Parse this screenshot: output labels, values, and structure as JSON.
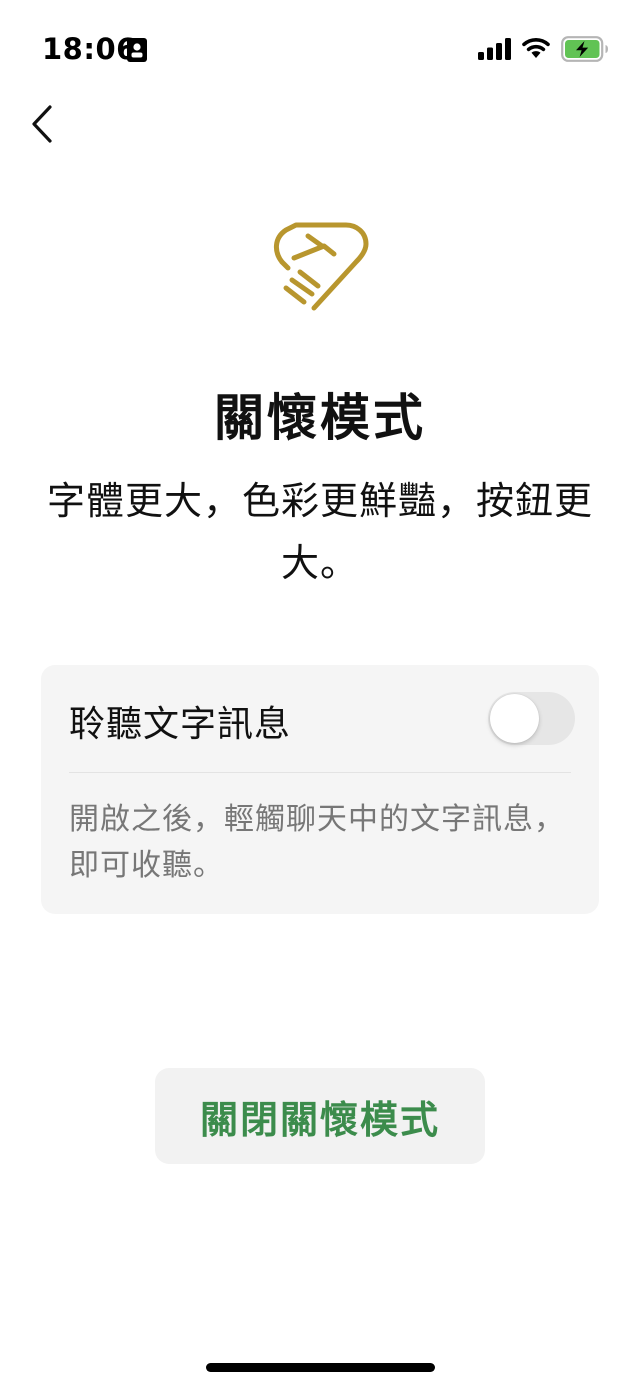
{
  "status_bar": {
    "time": "18:06"
  },
  "header": {
    "back_icon": "chevron-left-icon"
  },
  "logo": {
    "icon": "heart-hands-icon",
    "color": "#B8962E"
  },
  "title": "關懷模式",
  "subtitle": "字體更大，色彩更鮮豔，按鈕更大。",
  "listen_card": {
    "label": "聆聽文字訊息",
    "toggle_on": false,
    "description": "開啟之後，輕觸聊天中的文字訊息，即可收聽。"
  },
  "close_button": {
    "label": "關閉關懷模式",
    "color": "#3C8C4C"
  },
  "colors": {
    "background": "#FFFFFF",
    "card": "#F5F5F5",
    "accent_green": "#3C8C4C",
    "battery_green": "#61C354"
  }
}
